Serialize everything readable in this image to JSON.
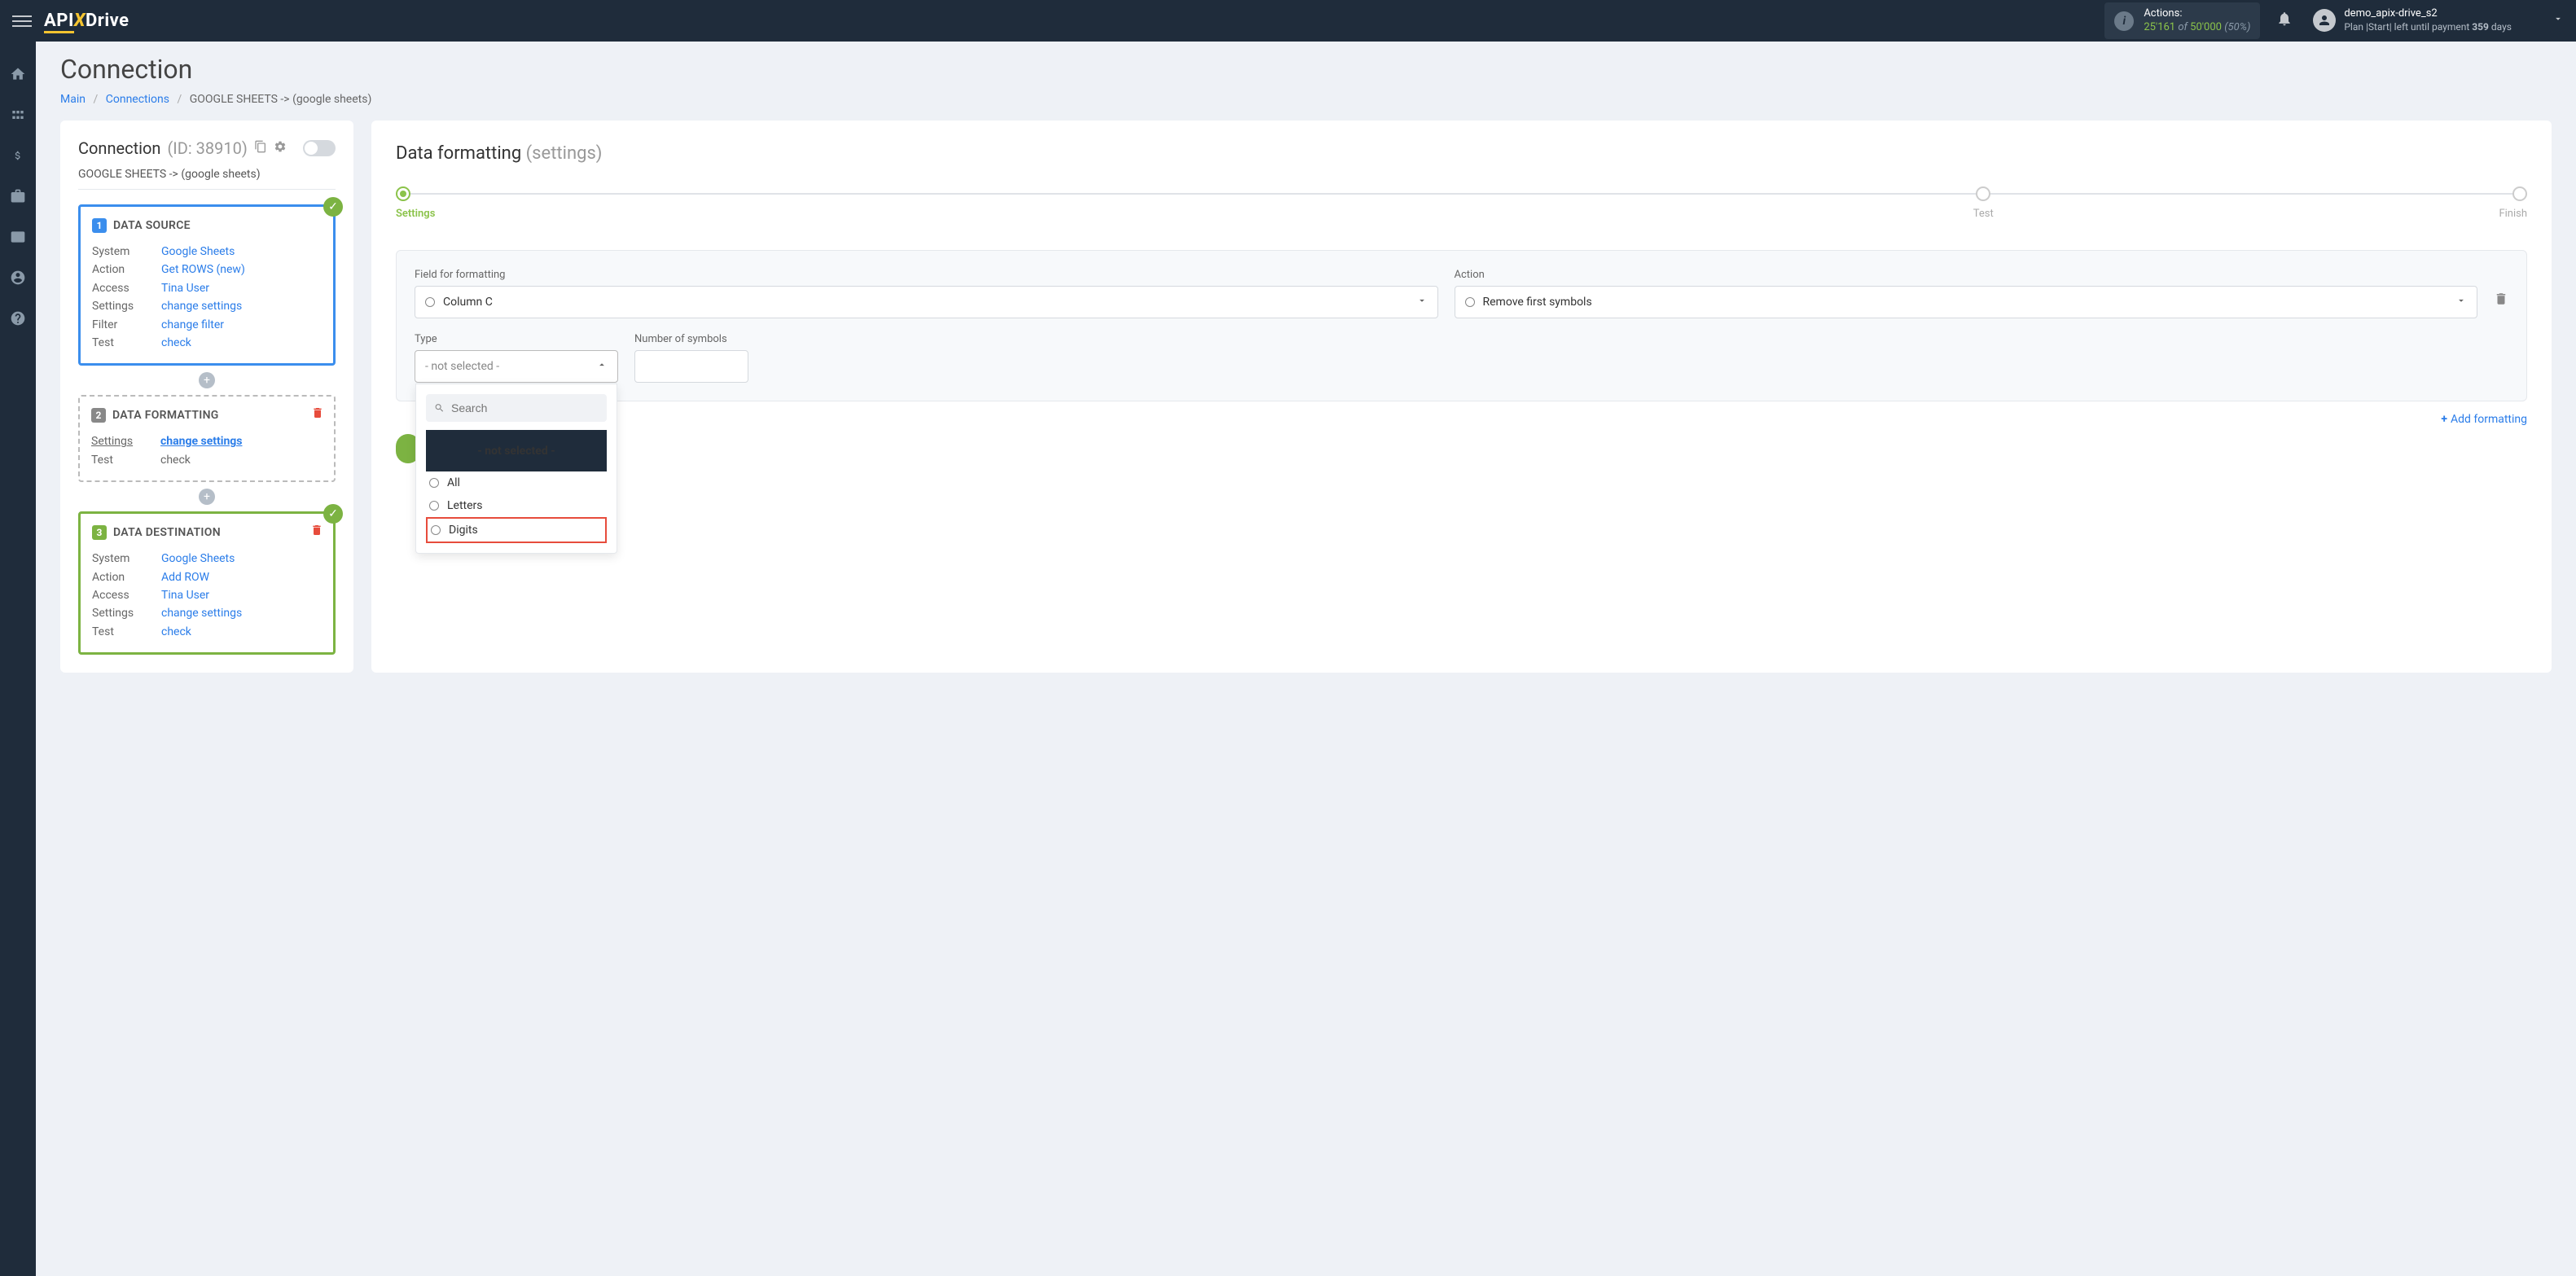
{
  "header": {
    "actions_label": "Actions:",
    "actions_count": "25'161",
    "actions_of": "of",
    "actions_total": "50'000",
    "actions_pct": "(50%)",
    "user_name": "demo_apix-drive_s2",
    "plan_prefix": "Plan |Start| left until payment ",
    "plan_days": "359",
    "plan_suffix": " days"
  },
  "page": {
    "title": "Connection",
    "breadcrumb": {
      "main": "Main",
      "connections": "Connections",
      "current": "GOOGLE SHEETS -> (google sheets)"
    }
  },
  "left": {
    "title": "Connection",
    "id_label": "(ID: 38910)",
    "subtitle": "GOOGLE SHEETS -> (google sheets)",
    "step1": {
      "title": "DATA SOURCE",
      "rows": {
        "system_l": "System",
        "system_v": "Google Sheets",
        "action_l": "Action",
        "action_v": "Get ROWS (new)",
        "access_l": "Access",
        "access_v": "Tina User",
        "settings_l": "Settings",
        "settings_v": "change settings",
        "filter_l": "Filter",
        "filter_v": "change filter",
        "test_l": "Test",
        "test_v": "check"
      }
    },
    "step2": {
      "title": "DATA FORMATTING",
      "rows": {
        "settings_l": "Settings",
        "settings_v": "change settings",
        "test_l": "Test",
        "test_v": "check"
      }
    },
    "step3": {
      "title": "DATA DESTINATION",
      "rows": {
        "system_l": "System",
        "system_v": "Google Sheets",
        "action_l": "Action",
        "action_v": "Add ROW",
        "access_l": "Access",
        "access_v": "Tina User",
        "settings_l": "Settings",
        "settings_v": "change settings",
        "test_l": "Test",
        "test_v": "check"
      }
    }
  },
  "right": {
    "title": "Data formatting",
    "subtitle": "(settings)",
    "stepper": {
      "s1": "Settings",
      "s2": "Test",
      "s3": "Finish"
    },
    "form": {
      "field_label": "Field for formatting",
      "field_value": "Column C",
      "action_label": "Action",
      "action_value": "Remove first symbols",
      "type_label": "Type",
      "type_value": "- not selected -",
      "num_label": "Number of symbols",
      "search_placeholder": "Search",
      "options": {
        "none": "- not selected -",
        "all": "All",
        "letters": "Letters",
        "digits": "Digits"
      }
    },
    "add_link": "Add formatting"
  }
}
